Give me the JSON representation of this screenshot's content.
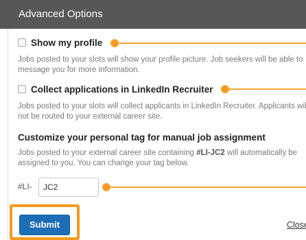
{
  "header": {
    "title": "Advanced Options"
  },
  "options": {
    "show_profile": {
      "label": "Show my profile",
      "checked": false,
      "description": "Jobs posted to your slots will show your profile picture. Job seekers will be able to message you for more information."
    },
    "collect_applications": {
      "label": "Collect applications in LinkedIn Recruiter",
      "checked": false,
      "description": "Jobs posted to your slots will collect applicants in LinkedIn Recruiter. Applicants will not be routed to your external career site."
    }
  },
  "personal_tag": {
    "heading": "Customize your personal tag for manual job assignment",
    "description_before": "Jobs posted to your external career site containing ",
    "description_tag": "#LI-JC2",
    "description_after": " will automatically be assigned to you. You can change your tag below.",
    "prefix": "#LI-",
    "value": "JC2"
  },
  "actions": {
    "submit_label": "Submit",
    "close_label": "Close"
  },
  "colors": {
    "header_bg": "#575757",
    "accent_orange": "#f39a1f",
    "submit_blue": "#1d6eb6"
  }
}
